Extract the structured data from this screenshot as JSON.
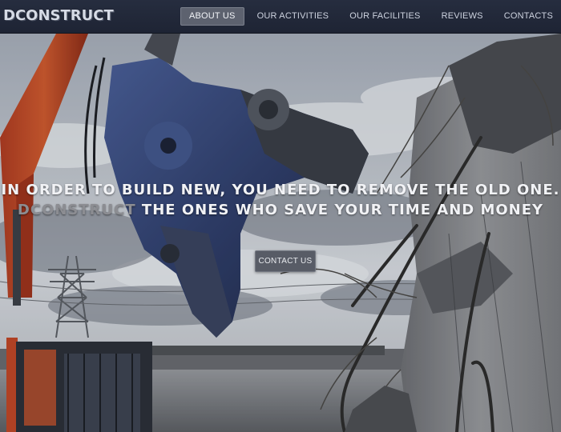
{
  "nav": {
    "logo_text": "DCONSTRUCT",
    "items": [
      {
        "label": "ABOUT US",
        "active": true
      },
      {
        "label": "OUR ACTIVITIES",
        "active": false
      },
      {
        "label": "OUR FACILITIES",
        "active": false
      },
      {
        "label": "REVIEWS",
        "active": false
      },
      {
        "label": "CONTACTS",
        "active": false
      }
    ]
  },
  "hero": {
    "headline_part1": "IN ORDER TO BUILD NEW, YOU NEED TO REMOVE THE OLD ONE.",
    "brand": "DCONSTRUCT",
    "headline_part2": "THE ONES WHO SAVE YOUR TIME AND MONEY",
    "cta_label": "CONTACT US"
  },
  "colors": {
    "nav_bg": "#232a3b",
    "active_tab": "#5d626f",
    "button_bg": "#585c66"
  }
}
